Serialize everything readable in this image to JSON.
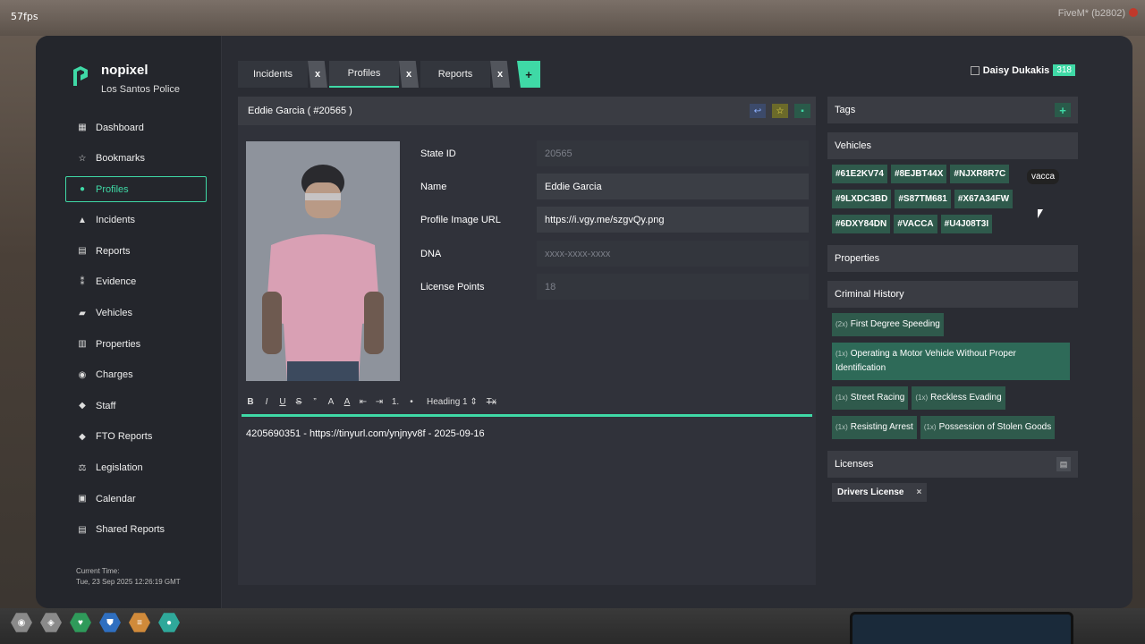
{
  "overlay": {
    "fps": "57fps",
    "fivem": "FiveM* (b2802)"
  },
  "brand": {
    "name": "nopixel",
    "subtitle": "Los Santos Police"
  },
  "sidebar": {
    "items": [
      {
        "label": "Dashboard",
        "icon": "dashboard-icon"
      },
      {
        "label": "Bookmarks",
        "icon": "star-icon"
      },
      {
        "label": "Profiles",
        "icon": "person-icon",
        "active": true
      },
      {
        "label": "Incidents",
        "icon": "warning-icon"
      },
      {
        "label": "Reports",
        "icon": "document-icon"
      },
      {
        "label": "Evidence",
        "icon": "footprints-icon"
      },
      {
        "label": "Vehicles",
        "icon": "car-icon"
      },
      {
        "label": "Properties",
        "icon": "building-icon"
      },
      {
        "label": "Charges",
        "icon": "location-icon"
      },
      {
        "label": "Staff",
        "icon": "graduation-cap-icon"
      },
      {
        "label": "FTO Reports",
        "icon": "graduation-cap-icon"
      },
      {
        "label": "Legislation",
        "icon": "gavel-icon"
      },
      {
        "label": "Calendar",
        "icon": "calendar-icon"
      },
      {
        "label": "Shared Reports",
        "icon": "document-icon"
      }
    ],
    "time_label": "Current Time:",
    "time_value": "Tue, 23 Sep 2025 12:26:19 GMT"
  },
  "tabs": [
    {
      "label": "Incidents",
      "close": "x"
    },
    {
      "label": "Profiles",
      "close": "x",
      "active": true
    },
    {
      "label": "Reports",
      "close": "x"
    }
  ],
  "tab_add": "+",
  "user": {
    "name": "Daisy Dukakis",
    "badge": "318"
  },
  "profile": {
    "header": "Eddie Garcia ( #20565 )",
    "fields": [
      {
        "label": "State ID",
        "value": "20565",
        "dim": true
      },
      {
        "label": "Name",
        "value": "Eddie Garcia"
      },
      {
        "label": "Profile Image URL",
        "value": "https://i.vgy.me/szgvQy.png"
      },
      {
        "label": "DNA",
        "value": "xxxx-xxxx-xxxx",
        "dim": true
      },
      {
        "label": "License Points",
        "value": "18",
        "dim": true
      }
    ]
  },
  "editor": {
    "toolbar": [
      "B",
      "I",
      "U",
      "S",
      "”",
      "A",
      "A",
      "⇤",
      "⇥",
      "1.",
      "•"
    ],
    "heading": "Heading 1",
    "clear": "Tx",
    "text": "4205690351 - https://tinyurl.com/ynjnyv8f - 2025-09-16"
  },
  "right": {
    "tags_title": "Tags",
    "vehicles_title": "Vehicles",
    "vehicles": [
      "#61E2KV74",
      "#8EJBT44X",
      "#NJXR8R7C",
      "#9LXDC3BD",
      "#S87TM681",
      "#X67A34FW",
      "#6DXY84DN",
      "#VACCA",
      "#U4J08T3I"
    ],
    "properties_title": "Properties",
    "criminal_title": "Criminal History",
    "charges": [
      {
        "count": "(2x)",
        "name": "First Degree Speeding"
      },
      {
        "count": "(1x)",
        "name": "Operating a Motor Vehicle Without Proper Identification",
        "wide": true
      },
      {
        "count": "(1x)",
        "name": "Street Racing"
      },
      {
        "count": "(1x)",
        "name": "Reckless Evading"
      },
      {
        "count": "(1x)",
        "name": "Resisting Arrest"
      },
      {
        "count": "(1x)",
        "name": "Possession of Stolen Goods"
      }
    ],
    "licenses_title": "Licenses",
    "license": "Drivers License",
    "license_remove": "×"
  },
  "tooltip": "vacca",
  "colors": {
    "accent": "#3fd9a6",
    "panel": "#2a2c33",
    "chip": "#2f5a4c"
  }
}
